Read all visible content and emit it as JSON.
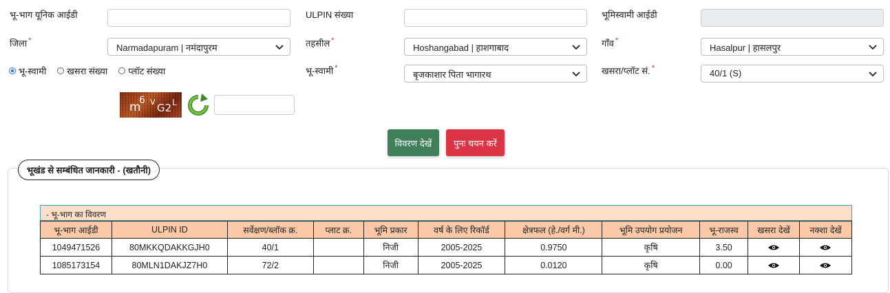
{
  "fields": {
    "unique_id_label": "भू-भाग यूनिक आईडी",
    "ulpin_label": "ULPIN संख्या",
    "owner_id_label": "भूमिस्वामी आईडी",
    "district_label": "जिला",
    "district_value": "Narmadapuram | नमंदापुरम",
    "tehsil_label": "तहसील",
    "tehsil_value": "Hoshangabad | हाशगाबाद",
    "village_label": "गाँव",
    "village_value": "Hasalpur | हासलपुर",
    "owner_label": "भू-स्वामी",
    "owner_value": "बृजकाशार पिता भागारथ",
    "khasra_label": "खसरा/प्लॉट सं.",
    "khasra_value": "40/1 (S)",
    "required_mark": "*"
  },
  "search_mode": {
    "options": [
      "भू-स्वामी",
      "खसरा संख्या",
      "प्लॉट संख्या"
    ],
    "selected": 0
  },
  "captcha": {
    "text_parts": [
      "m",
      "6",
      "V",
      "G2",
      "L"
    ]
  },
  "buttons": {
    "view": "विवरण देखें",
    "reset": "पुनः चयन करें",
    "view_color": "#3f7f5a",
    "reset_color": "#db3545"
  },
  "section": {
    "title": "भूखंड से सम्बंधित जानकारी -   (खतौनी)"
  },
  "table": {
    "title": "- भू-भाग का विवरण",
    "headers": [
      "भू-भाग आईडी",
      "ULPIN ID",
      "सर्वेक्षण/ब्लॉक क्र.",
      "प्लाट क्र.",
      "भूमि प्रकार",
      "वर्ष के लिए रिकॉर्ड",
      "क्षेत्रफल (हे./वर्ग मी.)",
      "भूमि उपयोग प्रयोजन",
      "भू-राजस्व",
      "खसरा देखें",
      "नक्शा देखें"
    ],
    "rows": [
      [
        "1049471526",
        "80MKKQDAKKGJH0",
        "40/1",
        "",
        "निजी",
        "2005-2025",
        "0.9750",
        "कृषि",
        "3.50"
      ],
      [
        "1085173154",
        "80MLN1DAKJZ7H0",
        "72/2",
        "",
        "निजी",
        "2005-2025",
        "0.0120",
        "कृषि",
        "0.00"
      ]
    ]
  }
}
